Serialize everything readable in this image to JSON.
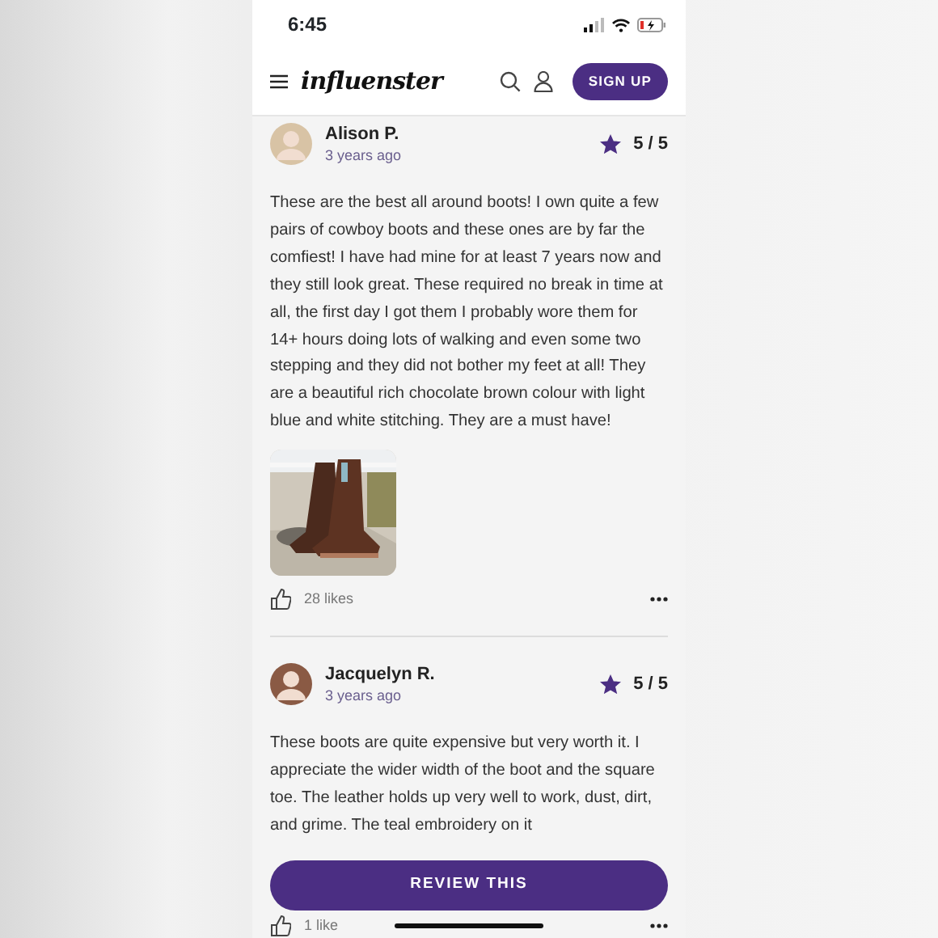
{
  "status_bar": {
    "time": "6:45"
  },
  "header": {
    "logo": "influenster",
    "sign_up": "SIGN UP"
  },
  "reviews": [
    {
      "author": "Alison P.",
      "time": "3 years ago",
      "rating": "5 / 5",
      "text": "These are the best all around boots! I own quite a few pairs of cowboy boots and these ones are by far the comfiest! I have had mine for at least 7 years now and they still look great. These required no break in time at all, the first day I got them I probably wore them for 14+ hours doing lots of walking and even some two stepping and they did not bother my feet at all! They are a beautiful rich chocolate brown colour with light blue and white stitching. They are a must have!",
      "likes": "28 likes"
    },
    {
      "author": "Jacquelyn R.",
      "time": "3 years ago",
      "rating": "5 / 5",
      "text": "These boots are quite expensive but very worth it. I appreciate the wider width of the boot and the square toe. The leather holds up very well to work, dust, dirt, and grime. The teal embroidery on it",
      "likes": "1 like"
    }
  ],
  "review_button": "REVIEW THIS"
}
